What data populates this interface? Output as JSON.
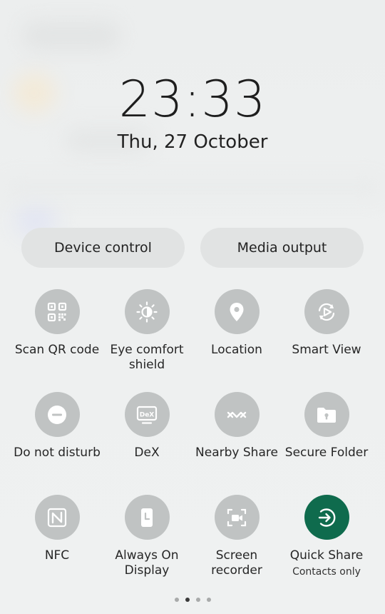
{
  "lockscreen": {
    "time": "23:33",
    "date": "Thu, 27 October"
  },
  "buttons": {
    "device_control": "Device control",
    "media_output": "Media output"
  },
  "tiles": [
    {
      "label": "Scan QR code",
      "icon": "qr-code-icon"
    },
    {
      "label": "Eye comfort shield",
      "icon": "eye-comfort-icon"
    },
    {
      "label": "Location",
      "icon": "location-pin-icon"
    },
    {
      "label": "Smart View",
      "icon": "smart-view-icon"
    },
    {
      "label": "Do not disturb",
      "icon": "do-not-disturb-icon"
    },
    {
      "label": "DeX",
      "icon": "dex-icon"
    },
    {
      "label": "Nearby Share",
      "icon": "nearby-share-icon"
    },
    {
      "label": "Secure Folder",
      "icon": "secure-folder-icon"
    },
    {
      "label": "NFC",
      "icon": "nfc-icon"
    },
    {
      "label": "Always On Display",
      "icon": "always-on-display-icon"
    },
    {
      "label": "Screen recorder",
      "icon": "screen-recorder-icon"
    },
    {
      "label": "Quick Share",
      "sublabel": "Contacts only",
      "icon": "quick-share-icon",
      "active": true
    }
  ],
  "colors": {
    "tile_inactive": "#c0c3c3",
    "tile_active": "#0f6b4d",
    "icon": "#ffffff"
  },
  "page_indicator": {
    "count": 4,
    "current": 2
  }
}
